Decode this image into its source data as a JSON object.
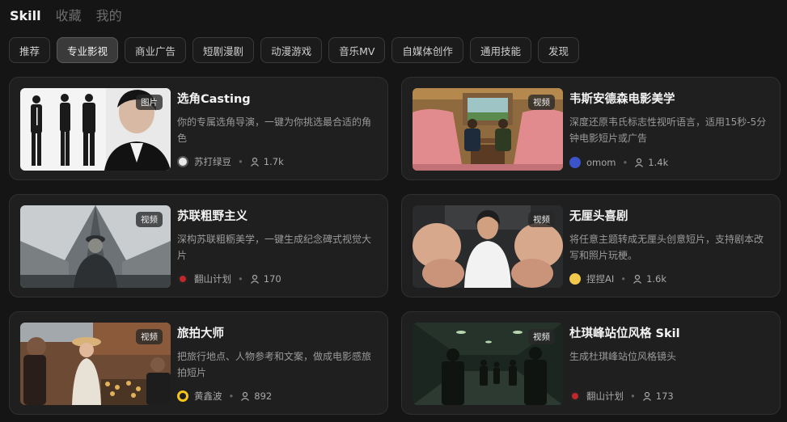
{
  "top_tabs": [
    "Skill",
    "收藏",
    "我的"
  ],
  "chips": [
    "推荐",
    "专业影视",
    "商业广告",
    "短剧漫剧",
    "动漫游戏",
    "音乐MV",
    "自媒体创作",
    "通用技能",
    "发现"
  ],
  "active_chip": "专业影视",
  "cards": [
    {
      "title": "选角Casting",
      "badge": "图片",
      "desc": "你的专属选角导演，一键为你挑选最合适的角色",
      "author": "苏打绿豆",
      "count": "1.7k",
      "avatar_color": "#e8e8e8",
      "thumb_icon": "casting-thumbnail"
    },
    {
      "title": "韦斯安德森电影美学",
      "badge": "视频",
      "desc": "深度还原韦氏标志性视听语言，适用15秒-5分钟电影短片或广告",
      "author": "omom",
      "count": "1.4k",
      "avatar_color": "#3b54c9",
      "thumb_icon": "train-carriage-thumbnail"
    },
    {
      "title": "苏联粗野主义",
      "badge": "视频",
      "desc": "深构苏联粗粝美学，一键生成纪念碑式视觉大片",
      "author": "翻山计划",
      "count": "170",
      "avatar_color": "#c0282b",
      "thumb_icon": "monument-soldier-thumbnail"
    },
    {
      "title": "无厘头喜剧",
      "badge": "视频",
      "desc": "将任意主题转成无厘头创意短片，支持剧本改写和照片玩梗。",
      "author": "捏捏AI",
      "count": "1.6k",
      "avatar_color": "#f2c94c",
      "thumb_icon": "muscle-comedy-thumbnail"
    },
    {
      "title": "旅拍大师",
      "badge": "视频",
      "desc": "把旅行地点、人物参考和文案，做成电影感旅拍短片",
      "author": "黄鑫波",
      "count": "892",
      "avatar_color": "#f5c518",
      "thumb_icon": "travel-market-thumbnail"
    },
    {
      "title": "杜琪峰站位风格 Skil",
      "badge": "视频",
      "desc": "生成杜琪峰站位风格镜头",
      "author": "翻山计划",
      "count": "173",
      "avatar_color": "#c0282b",
      "thumb_icon": "gangster-corridor-thumbnail"
    }
  ]
}
